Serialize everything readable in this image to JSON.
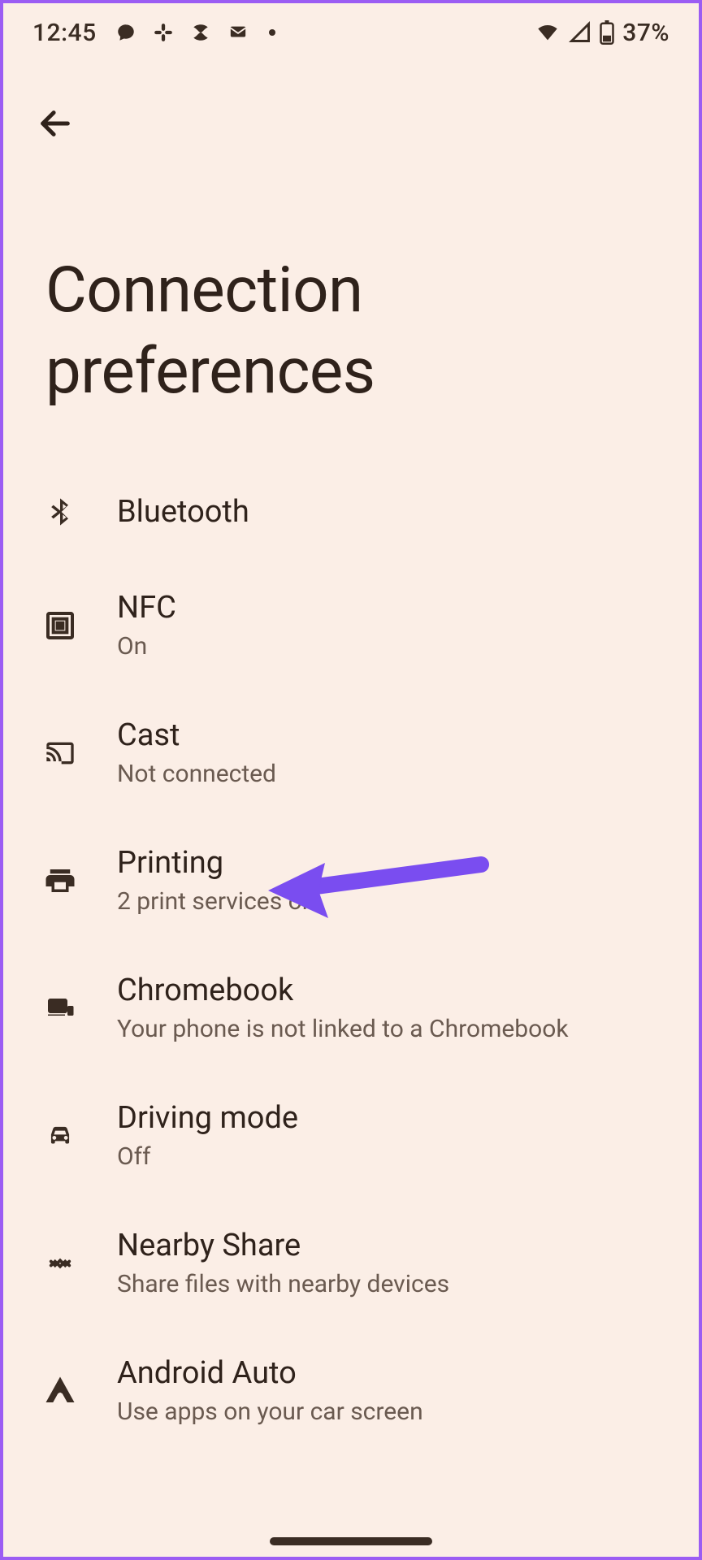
{
  "status": {
    "time": "12:45",
    "battery_text": "37%",
    "notif_icons": [
      "chat-bubble-icon",
      "slack-icon",
      "app-icon",
      "mail-icon",
      "more-dot-icon"
    ],
    "right_icons": [
      "wifi-icon",
      "cell-signal-icon",
      "battery-icon"
    ]
  },
  "page": {
    "title": "Connection preferences"
  },
  "items": [
    {
      "icon": "bluetooth-icon",
      "label": "Bluetooth",
      "sub": ""
    },
    {
      "icon": "nfc-icon",
      "label": "NFC",
      "sub": "On"
    },
    {
      "icon": "cast-icon",
      "label": "Cast",
      "sub": "Not connected"
    },
    {
      "icon": "print-icon",
      "label": "Printing",
      "sub": "2 print services on"
    },
    {
      "icon": "chromebook-icon",
      "label": "Chromebook",
      "sub": "Your phone is not linked to a Chromebook"
    },
    {
      "icon": "car-icon",
      "label": "Driving mode",
      "sub": "Off"
    },
    {
      "icon": "nearby-share-icon",
      "label": "Nearby Share",
      "sub": "Share files with nearby devices"
    },
    {
      "icon": "android-auto-icon",
      "label": "Android Auto",
      "sub": "Use apps on your car screen"
    }
  ],
  "annotation": {
    "color": "#7a4df0",
    "target_item_index": 3
  }
}
